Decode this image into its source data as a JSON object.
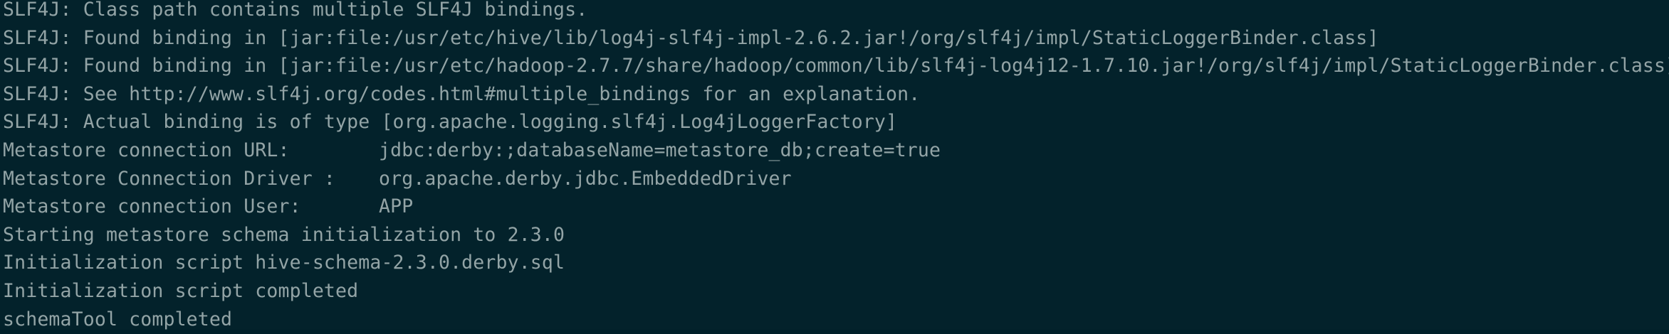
{
  "terminal": {
    "background_color": "#03222b",
    "text_color": "#93a4a6",
    "lines": [
      "SLF4J: Class path contains multiple SLF4J bindings.",
      "SLF4J: Found binding in [jar:file:/usr/etc/hive/lib/log4j-slf4j-impl-2.6.2.jar!/org/slf4j/impl/StaticLoggerBinder.class]",
      "SLF4J: Found binding in [jar:file:/usr/etc/hadoop-2.7.7/share/hadoop/common/lib/slf4j-log4j12-1.7.10.jar!/org/slf4j/impl/StaticLoggerBinder.class]",
      "SLF4J: See http://www.slf4j.org/codes.html#multiple_bindings for an explanation.",
      "SLF4J: Actual binding is of type [org.apache.logging.slf4j.Log4jLoggerFactory]"
    ],
    "metastore": {
      "url_label": "Metastore connection URL:",
      "url_value": "jdbc:derby:;databaseName=metastore_db;create=true",
      "driver_label": "Metastore Connection Driver :",
      "driver_value": "org.apache.derby.jdbc.EmbeddedDriver",
      "user_label": "Metastore connection User:",
      "user_value": "APP"
    },
    "tail_lines": [
      "Starting metastore schema initialization to 2.3.0",
      "Initialization script hive-schema-2.3.0.derby.sql",
      "Initialization script completed",
      "schemaTool completed"
    ]
  }
}
